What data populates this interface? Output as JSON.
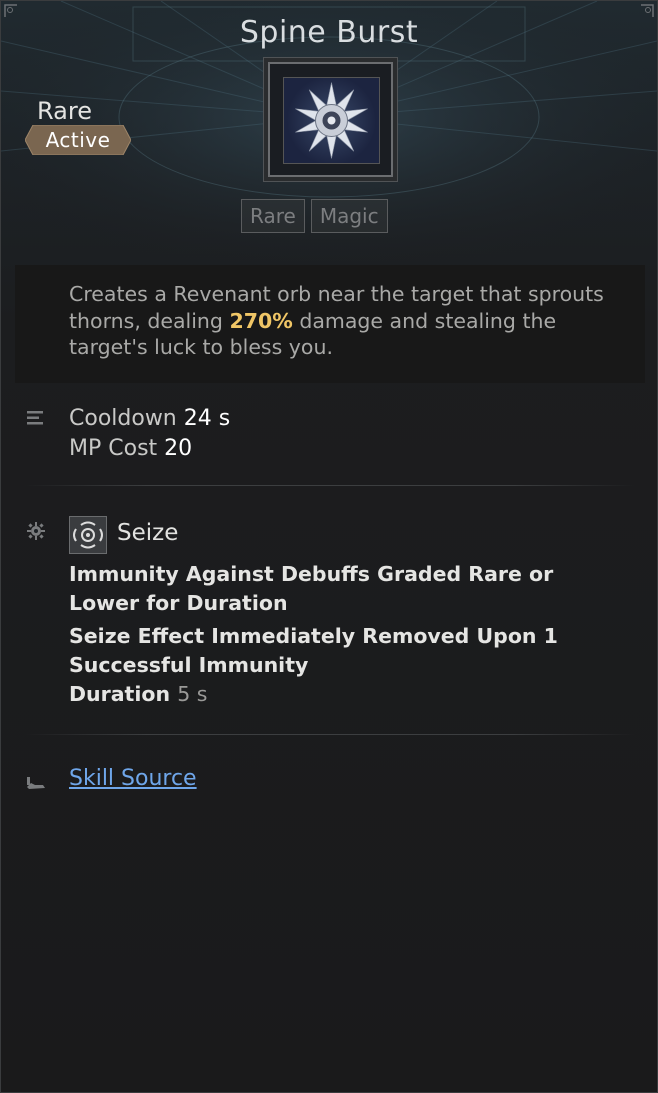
{
  "skill": {
    "name": "Spine Burst",
    "grade": "Rare",
    "type": "Active",
    "icon": "spiked-orb-icon",
    "tags": [
      "Rare",
      "Magic"
    ]
  },
  "description": {
    "before": "Creates a Revenant orb near the target that sprouts thorns, dealing ",
    "highlight": "270%",
    "after": " damage and stealing the target's luck to bless you."
  },
  "stats": {
    "cooldown_label": "Cooldown",
    "cooldown_value": "24 s",
    "mp_label": "MP Cost",
    "mp_value": "20"
  },
  "effect": {
    "name": "Seize",
    "line1": "Immunity Against Debuffs Graded Rare or Lower for Duration",
    "line2": "Seize Effect Immediately Removed Upon 1 Successful Immunity",
    "duration_label": "Duration",
    "duration_value": "5 s"
  },
  "source": {
    "label": "Skill Source"
  },
  "colors": {
    "highlight": "#f0c666",
    "link": "#6fa6ea",
    "badge": "#7a6650"
  }
}
